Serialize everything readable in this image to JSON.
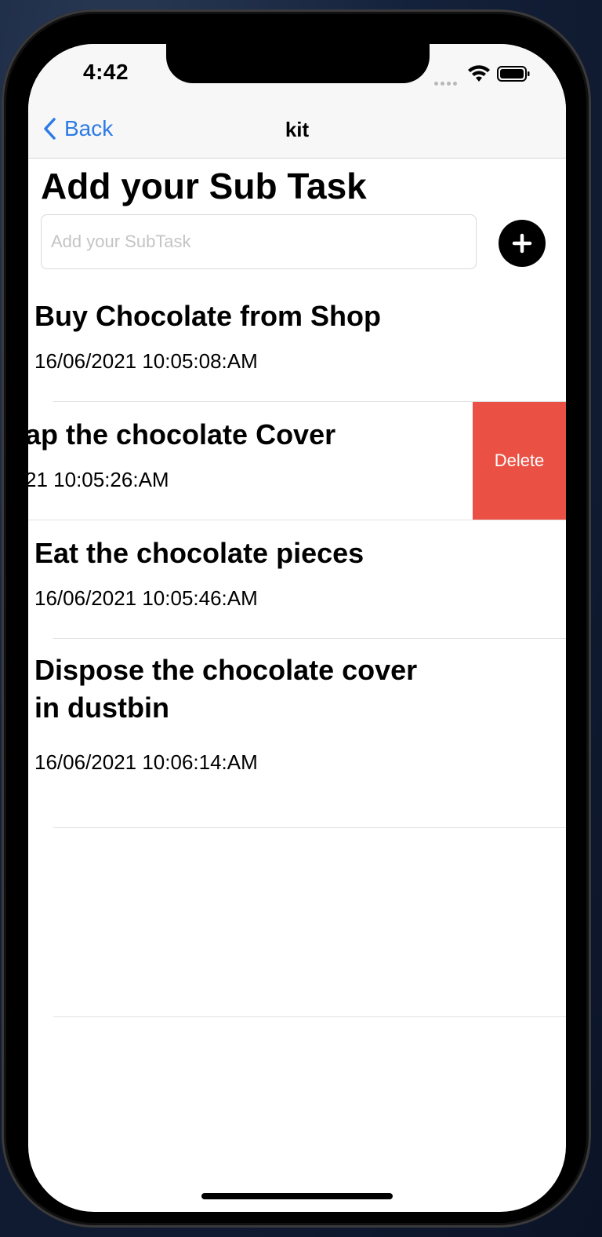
{
  "status_bar": {
    "time": "4:42"
  },
  "nav": {
    "back_label": "Back",
    "title": "kit"
  },
  "main": {
    "heading": "Add your Sub Task",
    "input_placeholder": "Add your SubTask",
    "input_value": ""
  },
  "tasks": [
    {
      "title": "Buy Chocolate from Shop",
      "date": "16/06/2021 10:05:08:AM"
    },
    {
      "title": "ap the chocolate Cover",
      "date": "21 10:05:26:AM",
      "action_label": "Delete"
    },
    {
      "title": "Eat the chocolate pieces",
      "date": "16/06/2021 10:05:46:AM"
    },
    {
      "title_line1": "Dispose the chocolate cover",
      "title_line2": "in dustbin",
      "date": "16/06/2021 10:06:14:AM"
    }
  ],
  "colors": {
    "accent": "#2c7be5",
    "delete": "#ea5144"
  },
  "icons": [
    "chevron-left-icon",
    "plus-icon",
    "wifi-icon",
    "battery-icon",
    "cellular-signal-icon"
  ]
}
